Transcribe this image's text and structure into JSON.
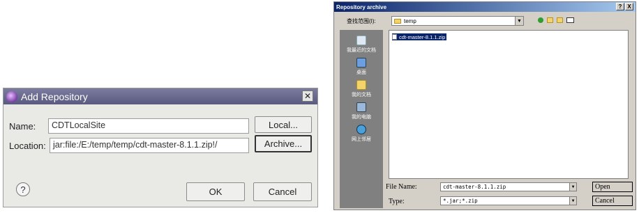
{
  "add_repository": {
    "title": "Add Repository",
    "close_glyph": "✕",
    "name_label": "Name:",
    "name_value": "CDTLocalSite",
    "location_label": "Location:",
    "location_value": "jar:file:/E:/temp/temp/cdt-master-8.1.1.zip!/",
    "local_button": "Local...",
    "archive_button": "Archive...",
    "help_glyph": "?",
    "ok_button": "OK",
    "cancel_button": "Cancel",
    "icons": [
      "eclipse-app-icon",
      "help-icon",
      "close-icon"
    ]
  },
  "repository_archive": {
    "title": "Repository archive",
    "titlebar_buttons": [
      "?",
      "X"
    ],
    "look_in_label": "查找范围(I):",
    "look_in_value": "temp",
    "places": [
      "我最近的文档",
      "桌面",
      "我的文档",
      "我的电脑",
      "网上邻居"
    ],
    "files": [
      "cdt-master-8.1.1.zip"
    ],
    "file_name_label": "File Name:",
    "file_name_value": "cdt-master-8.1.1.zip",
    "type_label": "Type:",
    "type_value": "*.jar;*.zip",
    "open_button": "Open",
    "cancel_button": "Cancel",
    "icons": [
      "folder-icon",
      "back-icon",
      "up-folder-icon",
      "new-folder-icon",
      "view-menu-icon"
    ]
  }
}
